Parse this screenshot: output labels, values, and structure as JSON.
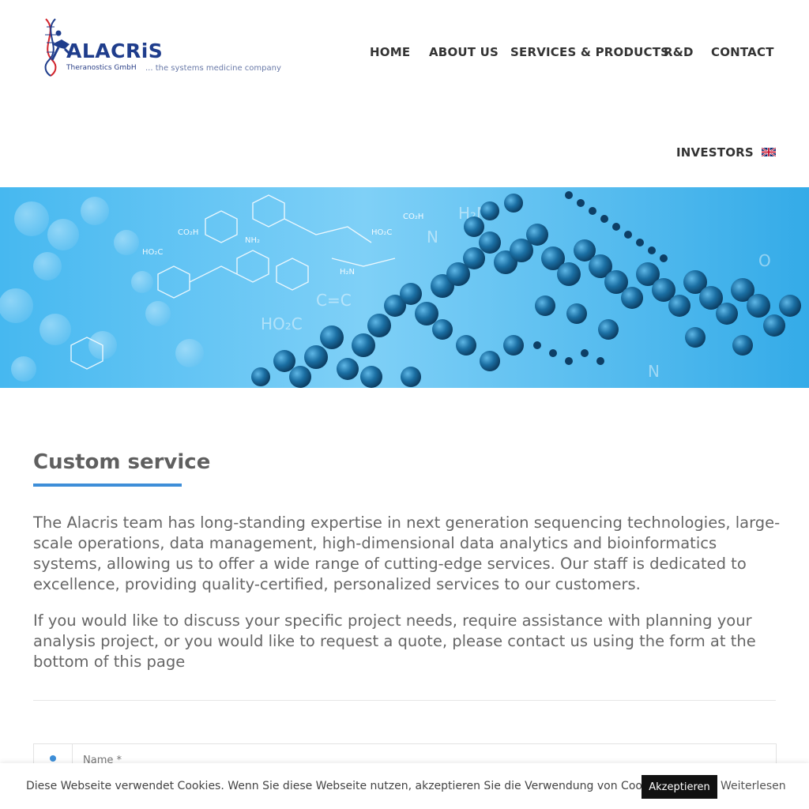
{
  "brand": {
    "logo_name": "ALACRiS",
    "logo_subtitle": "Theranostics GmbH",
    "tagline": "... the systems medicine company",
    "primary_color": "#1f3d8c",
    "accent_color": "#d3242c"
  },
  "nav": {
    "items": [
      {
        "label": "HOME"
      },
      {
        "label": "ABOUT US"
      },
      {
        "label": "SERVICES & PRODUCTS"
      },
      {
        "label": "R&D"
      },
      {
        "label": "CONTACT"
      },
      {
        "label": "INVESTORS"
      }
    ],
    "language_flag_icon": "uk-flag-icon"
  },
  "banner": {
    "image_description_icon": "dna-molecule-banner",
    "base_color": "#3fb5ef"
  },
  "content": {
    "title": "Custom service",
    "accent_color": "#3d8ed8",
    "paragraphs": [
      "The Alacris team has long-standing expertise in next generation sequencing technologies, large-scale operations, data management, high-dimensional data analytics and bioinformatics systems, allowing us to offer a wide range of cutting-edge services. Our staff is dedicated to excellence, providing quality-certified, personalized services to our customers.",
      "If you would like to discuss your specific project needs, require assistance with planning your analysis project, or you would like to request a quote, please contact us using the form at the bottom of this page"
    ]
  },
  "form": {
    "name_placeholder": "Name *",
    "name_icon": "user-icon"
  },
  "cookie": {
    "message": "Diese Webseite verwendet Cookies. Wenn Sie diese Webseite nutzen, akzeptieren Sie die Verwendung von Cookies.",
    "accept_label": "Akzeptieren",
    "more_label": "Weiterlesen"
  }
}
